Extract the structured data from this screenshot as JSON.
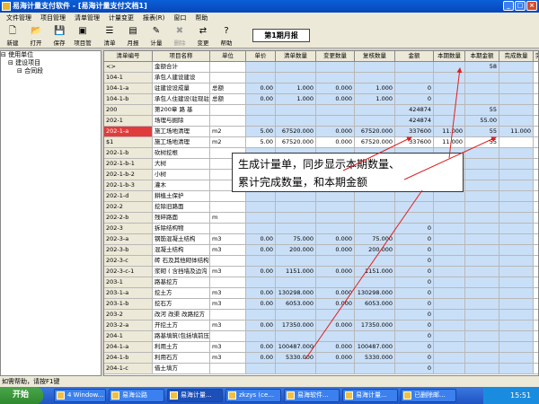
{
  "window": {
    "title": "易海计量支付软件 - [易海计量支付文档1]"
  },
  "menu": [
    "文件管理",
    "项目管理",
    "清单管理",
    "计量变更",
    "报表(R)",
    "窗口",
    "帮助"
  ],
  "toolbar": [
    {
      "label": "新建",
      "icon": "new-file-icon"
    },
    {
      "label": "打开",
      "icon": "open-folder-icon"
    },
    {
      "label": "保存",
      "icon": "save-icon"
    },
    {
      "label": "项目管",
      "icon": "project-icon"
    },
    {
      "label": "清单",
      "icon": "list-icon"
    },
    {
      "label": "月报",
      "icon": "report-icon"
    },
    {
      "label": "计量",
      "icon": "measure-icon"
    },
    {
      "label": "删除",
      "icon": "delete-icon"
    },
    {
      "label": "变更",
      "icon": "change-icon"
    },
    {
      "label": "帮助",
      "icon": "help-icon"
    }
  ],
  "period_button": "第1期月报",
  "tree": [
    "使用单位",
    "建设项目",
    "合同段"
  ],
  "columns": [
    "清单编号",
    "项目名称",
    "单位",
    "单价",
    "清单数量",
    "变更数量",
    "复核数量",
    "金额",
    "本期数量",
    "本期金额",
    "完成数量",
    "完"
  ],
  "rows": [
    [
      "<>",
      "金额合计",
      "",
      "",
      "",
      "",
      "",
      "",
      "",
      "58",
      "",
      ""
    ],
    [
      "104-1",
      "承包人建设建设",
      "",
      "",
      "",
      "",
      "",
      "",
      "",
      "",
      "",
      ""
    ],
    [
      "104-1-a",
      "驻建设设成量",
      "总额",
      "0.00",
      "1.000",
      "0.000",
      "1.000",
      "0",
      "",
      "",
      "",
      ""
    ],
    [
      "104-1-b",
      "承包人住建设(驻现驻地)",
      "总额",
      "0.00",
      "1.000",
      "0.000",
      "1.000",
      "0",
      "",
      "",
      "",
      ""
    ],
    [
      "200",
      "第200章  路  基",
      "",
      "",
      "",
      "",
      "",
      "424874",
      "",
      "55",
      "",
      ""
    ],
    [
      "202-1",
      "场理与掘除",
      "",
      "",
      "",
      "",
      "",
      "424874",
      "",
      "55.00",
      "",
      ""
    ],
    [
      "202-1-a",
      "施工场地清理",
      "m2",
      "5.00",
      "67520.000",
      "0.000",
      "67520.000",
      "337600",
      "11.000",
      "55",
      "11.000",
      ""
    ],
    [
      "$1",
      "施工场地清理",
      "m2",
      "5.00",
      "67520.000",
      "0.000",
      "67520.000",
      "337600",
      "11.000",
      "55",
      "",
      ""
    ],
    [
      "202-1-b",
      "砍树挖根",
      "",
      "",
      "",
      "",
      "",
      "",
      "",
      "",
      "",
      ""
    ],
    [
      "202-1-b-1",
      "大树",
      "",
      "",
      "",
      "",
      "",
      "",
      "",
      "",
      "",
      ""
    ],
    [
      "202-1-b-2",
      "小树",
      "",
      "",
      "",
      "",
      "",
      "",
      "",
      "",
      "",
      ""
    ],
    [
      "202-1-b-3",
      "灌木",
      "",
      "",
      "",
      "",
      "",
      "",
      "",
      "",
      "",
      ""
    ],
    [
      "202-1-d",
      "耕植土保护",
      "",
      "",
      "",
      "",
      "",
      "",
      "",
      "",
      "",
      ""
    ],
    [
      "202-2",
      "挖除旧路面",
      "",
      "",
      "",
      "",
      "",
      "",
      "",
      "",
      "",
      ""
    ],
    [
      "202-2-b",
      "残碎路面",
      "m",
      "",
      "",
      "",
      "",
      "",
      "",
      "",
      "",
      ""
    ],
    [
      "202-3",
      "拆除结构物",
      "",
      "",
      "",
      "",
      "",
      "0",
      "",
      "",
      "",
      ""
    ],
    [
      "202-3-a",
      "钢筋混凝土结构",
      "m3",
      "0.00",
      "75.000",
      "0.000",
      "75.000",
      "0",
      "",
      "",
      "",
      ""
    ],
    [
      "202-3-b",
      "混凝土结构",
      "m3",
      "0.00",
      "200.000",
      "0.000",
      "200.000",
      "0",
      "",
      "",
      "",
      ""
    ],
    [
      "202-3-c",
      "砖 石及其他砌体结构",
      "",
      "",
      "",
      "",
      "",
      "0",
      "",
      "",
      "",
      ""
    ],
    [
      "202-3-c-1",
      "浆砌 ( 含挡墙及边沟 )",
      "m3",
      "0.00",
      "1151.000",
      "0.000",
      "1151.000",
      "0",
      "",
      "",
      "",
      ""
    ],
    [
      "203-1",
      "路基挖方",
      "",
      "",
      "",
      "",
      "",
      "0",
      "",
      "",
      "",
      ""
    ],
    [
      "203-1-a",
      "挖土方",
      "m3",
      "0.00",
      "130298.000",
      "0.000",
      "130298.000",
      "0",
      "",
      "",
      "",
      ""
    ],
    [
      "203-1-b",
      "挖石方",
      "m3",
      "0.00",
      "6053.000",
      "0.000",
      "6053.000",
      "0",
      "",
      "",
      "",
      ""
    ],
    [
      "203-2",
      "改河 改渠 改路挖方",
      "",
      "",
      "",
      "",
      "",
      "0",
      "",
      "",
      "",
      ""
    ],
    [
      "203-2-a",
      "开挖土方",
      "m3",
      "0.00",
      "17350.000",
      "0.000",
      "17350.000",
      "0",
      "",
      "",
      "",
      ""
    ],
    [
      "204-1",
      "路基填筑(包括填前压实)",
      "",
      "",
      "",
      "",
      "",
      "0",
      "",
      "",
      "",
      ""
    ],
    [
      "204-1-a",
      "利用土方",
      "m3",
      "0.00",
      "100487.000",
      "0.000",
      "100487.000",
      "0",
      "",
      "",
      "",
      ""
    ],
    [
      "204-1-b",
      "利用石方",
      "m3",
      "0.00",
      "5330.000",
      "0.000",
      "5330.000",
      "0",
      "",
      "",
      "",
      ""
    ],
    [
      "204-1-c",
      "借土填方",
      "",
      "",
      "",
      "",
      "",
      "0",
      "",
      "",
      "",
      ""
    ]
  ],
  "callout": [
    "生成计量单，同步显示本期数量、",
    "累计完成数量，和本期金额"
  ],
  "status": "如需帮助，请按F1键",
  "taskbar": {
    "start": "开始",
    "tasks": [
      "4 Window...",
      "易海公路",
      "易海计量...",
      "zkzys (ce...",
      "易海软件...",
      "易海计量...",
      "已删除邮..."
    ],
    "time": "15:51"
  },
  "colors": {
    "selected_row_marker": "#e23b3b",
    "numeric_cell_bg": "#c9dff7",
    "annotation_arrow": "#e02020"
  }
}
